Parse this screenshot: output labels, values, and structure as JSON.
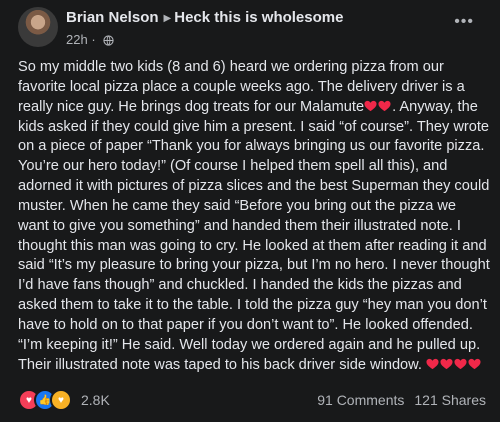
{
  "post": {
    "author": "Brian Nelson",
    "group": "Heck this is wholesome",
    "time": "22h",
    "more_label": "•••",
    "body_text": "So my middle two kids (8 and 6) heard we ordering pizza from our favorite local pizza place a couple weeks ago. The delivery driver is a really nice guy. He brings dog treats for our Malamute",
    "body_text_2": ". Anyway, the kids asked if they could give him a present. I said “of course”. They wrote on a piece of paper “Thank you for always bringing us our favorite pizza. You’re our hero today!” (Of course I helped them spell all this), and adorned it with pictures of pizza slices and the best Superman they could muster. When he came they said “Before you bring out the pizza we want to give you something” and handed them their illustrated note. I thought this man was going to cry. He looked at them after reading it and said “It’s my pleasure to bring your pizza, but I’m no hero. I never thought I’d have fans though” and chuckled. I handed the kids the pizzas and asked them to take it to the table. I told the pizza guy “hey man you don’t have to hold on to that paper if you don’t want to”. He looked offended. “I’m keeping it!” He said. Well today we ordered again and he pulled up. Their illustrated note was taped to his back driver side window. ",
    "reactions_count": "2.8K",
    "comments": "91 Comments",
    "shares": "121 Shares"
  },
  "colors": {
    "background": "#18191a",
    "text": "#e4e6eb",
    "secondary": "#b0b3b8",
    "heart": "#f02849",
    "love": "#f33e58",
    "like": "#1877f2",
    "care": "#f7b125"
  },
  "icons": [
    "avatar",
    "caret-right-icon",
    "globe-icon",
    "more-icon",
    "heart-icon",
    "love-reaction-icon",
    "like-reaction-icon",
    "care-reaction-icon"
  ]
}
